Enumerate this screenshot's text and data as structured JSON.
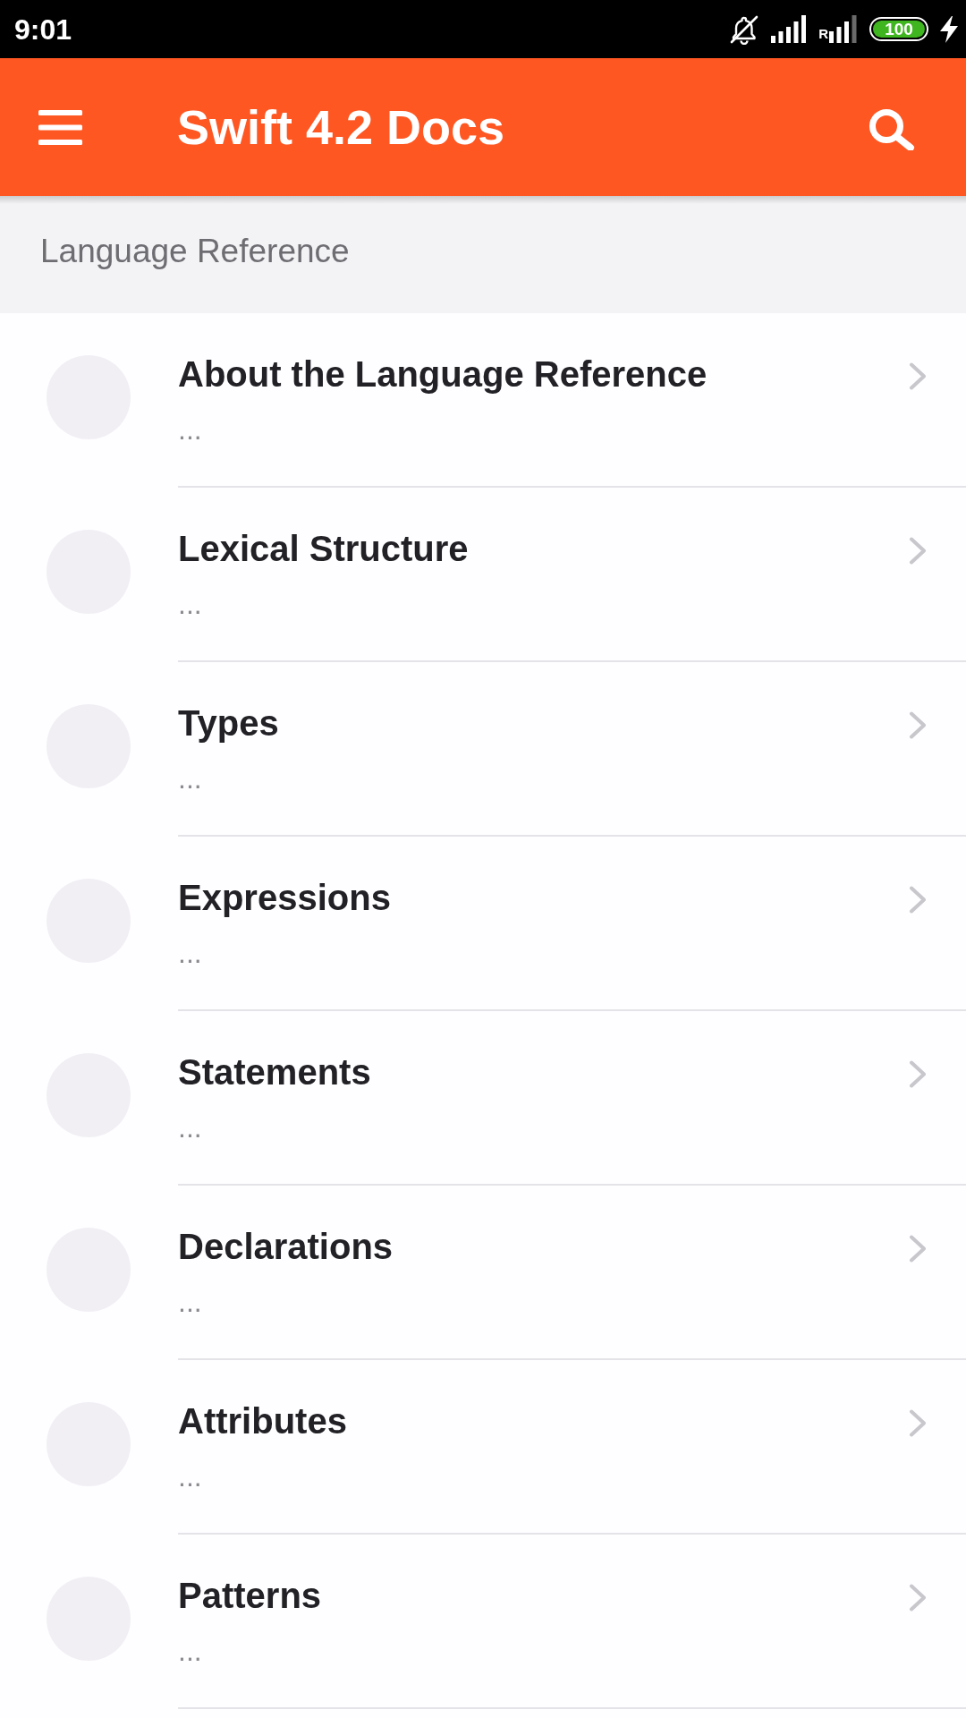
{
  "status_bar": {
    "time": "9:01",
    "roaming_label": "R",
    "battery": "100"
  },
  "app_bar": {
    "title": "Swift 4.2 Docs"
  },
  "section": {
    "title": "Language Reference"
  },
  "items": [
    {
      "title": "About the Language Reference",
      "subtitle": "..."
    },
    {
      "title": "Lexical Structure",
      "subtitle": "..."
    },
    {
      "title": "Types",
      "subtitle": "..."
    },
    {
      "title": "Expressions",
      "subtitle": "..."
    },
    {
      "title": "Statements",
      "subtitle": "..."
    },
    {
      "title": "Declarations",
      "subtitle": "..."
    },
    {
      "title": "Attributes",
      "subtitle": "..."
    },
    {
      "title": "Patterns",
      "subtitle": "..."
    }
  ]
}
